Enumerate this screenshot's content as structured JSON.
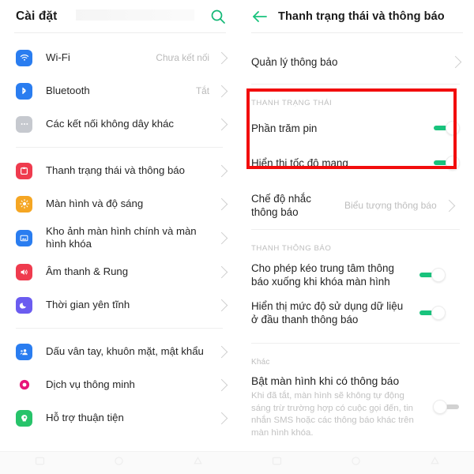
{
  "left_panel": {
    "header": {
      "title": "Cài đặt",
      "search_icon": "search-icon"
    },
    "groups": [
      {
        "items": [
          {
            "icon": "wifi-icon",
            "icon_color": "#2a7df0",
            "label": "Wi-Fi",
            "value": "Chưa kết nối",
            "chevron": true
          },
          {
            "icon": "bluetooth-icon",
            "icon_color": "#2a7df0",
            "label": "Bluetooth",
            "value": "Tắt",
            "chevron": true
          },
          {
            "icon": "more-dots-icon",
            "icon_color": "#c6c9cf",
            "label": "Các kết nối không dây khác",
            "value": "",
            "chevron": true
          }
        ]
      },
      {
        "items": [
          {
            "icon": "status-bar-icon",
            "icon_color": "#ef3b4e",
            "label": "Thanh trạng thái và thông báo",
            "value": "",
            "chevron": true
          },
          {
            "icon": "brightness-icon",
            "icon_color": "#f5a623",
            "label": "Màn hình và độ sáng",
            "value": "",
            "chevron": true
          },
          {
            "icon": "wallpaper-icon",
            "icon_color": "#2a7df0",
            "label": "Kho ảnh màn hình chính và màn hình khóa",
            "value": "",
            "chevron": true
          },
          {
            "icon": "sound-icon",
            "icon_color": "#ef3b4e",
            "label": "Âm thanh & Rung",
            "value": "",
            "chevron": true
          },
          {
            "icon": "moon-icon",
            "icon_color": "#6b5cf0",
            "label": "Thời gian yên tĩnh",
            "value": "",
            "chevron": true
          }
        ]
      },
      {
        "items": [
          {
            "icon": "fingerprint-face-icon",
            "icon_color": "#2a7df0",
            "label": "Dấu vân tay, khuôn mặt, mật khẩu",
            "value": "",
            "chevron": true
          },
          {
            "icon": "smart-service-icon",
            "icon_color": "#e8157a",
            "label": "Dịch vụ thông minh",
            "value": "",
            "chevron": true
          },
          {
            "icon": "accessibility-icon",
            "icon_color": "#27c36a",
            "label": "Hỗ trợ thuận tiện",
            "value": "",
            "chevron": true
          }
        ]
      }
    ]
  },
  "right_panel": {
    "header": {
      "back_icon": "back-arrow-icon",
      "title": "Thanh trạng thái và thông báo"
    },
    "notification_manager": {
      "label": "Quản lý thông báo",
      "chevron": true
    },
    "status_bar_section": {
      "title": "THANH TRẠNG THÁI",
      "items": [
        {
          "label": "Phần trăm pin",
          "toggle": "on"
        },
        {
          "label": "Hiển thị tốc độ mạng",
          "toggle": "on"
        }
      ]
    },
    "reminder_mode": {
      "label": "Chế độ nhắc thông báo",
      "value": "Biểu tượng thông báo",
      "chevron": true
    },
    "notification_bar_section": {
      "title": "THANH THÔNG BÁO",
      "items": [
        {
          "label": "Cho phép kéo trung tâm thông báo xuống khi khóa màn hình",
          "toggle": "on"
        },
        {
          "label": "Hiển thị mức độ sử dụng dữ liệu ở đầu thanh thông báo",
          "toggle": "on"
        }
      ]
    },
    "other_section": {
      "title": "Khác",
      "items": [
        {
          "label": "Bật màn hình khi có thông báo",
          "description": "Khi đã tắt, màn hình sẽ không tự động sáng trừ trường hợp có cuộc gọi đến, tin nhắn SMS hoặc các thông báo khác trên màn hình khóa.",
          "toggle": "off"
        }
      ]
    }
  },
  "highlight": {
    "color": "#f20d0d",
    "label": "status-bar-section-highlight"
  },
  "colors": {
    "accent_green": "#19c37d",
    "text_primary": "#242424",
    "text_muted": "#bdbdbd",
    "divider": "#efefef"
  }
}
